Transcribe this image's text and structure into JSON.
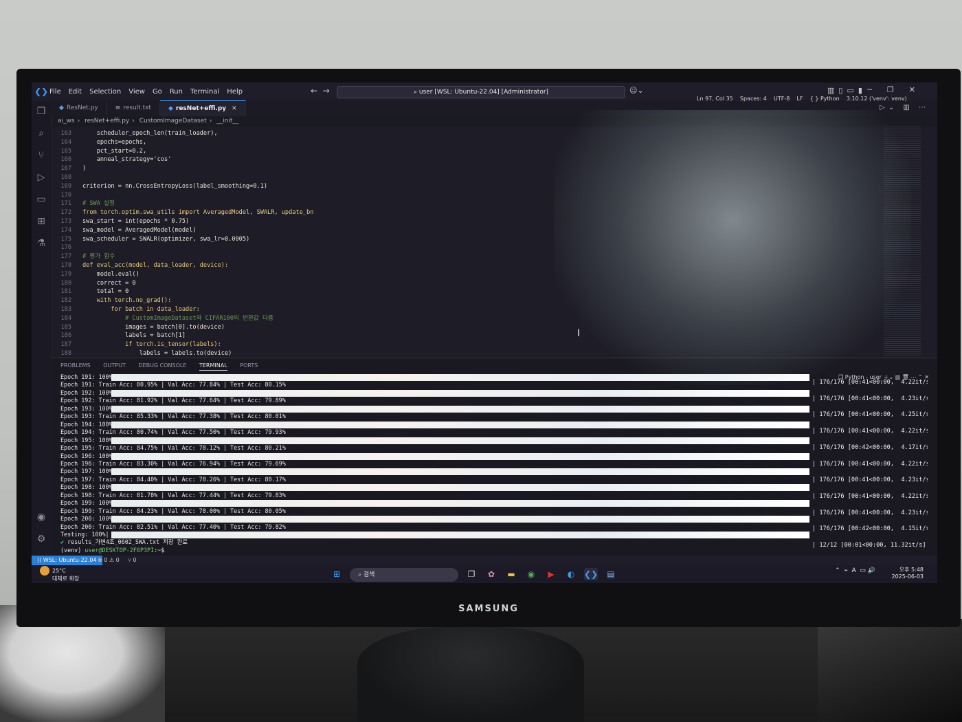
{
  "window": {
    "menu": [
      "File",
      "Edit",
      "Selection",
      "View",
      "Go",
      "Run",
      "Terminal",
      "Help"
    ],
    "command_center": "user [WSL: Ubuntu-22.04] [Administrator]"
  },
  "tabs": [
    {
      "label": "ResNet.py"
    },
    {
      "label": "result.txt"
    },
    {
      "label": "resNet+effi.py",
      "active": true
    }
  ],
  "breadcrumb": [
    "ai_ws",
    "resNet+effi.py",
    "CustomImageDataset",
    "__init__"
  ],
  "editor": {
    "lines": [
      {
        "n": "163",
        "t": "    scheduler_epoch_len(train_loader),"
      },
      {
        "n": "164",
        "t": "    epochs=epochs,"
      },
      {
        "n": "165",
        "t": "    pct_start=0.2,"
      },
      {
        "n": "166",
        "t": "    anneal_strategy='cos'"
      },
      {
        "n": "167",
        "t": ")"
      },
      {
        "n": "168",
        "t": ""
      },
      {
        "n": "169",
        "t": "criterion = nn.CrossEntropyLoss(label_smoothing=0.1)"
      },
      {
        "n": "170",
        "t": ""
      },
      {
        "n": "171",
        "t": "# SWA 설정"
      },
      {
        "n": "172",
        "t": "from torch.optim.swa_utils import AveragedModel, SWALR, update_bn"
      },
      {
        "n": "173",
        "t": "swa_start = int(epochs * 0.75)"
      },
      {
        "n": "174",
        "t": "swa_model = AveragedModel(model)"
      },
      {
        "n": "175",
        "t": "swa_scheduler = SWALR(optimizer, swa_lr=0.0005)"
      },
      {
        "n": "176",
        "t": ""
      },
      {
        "n": "177",
        "t": "# 평가 함수"
      },
      {
        "n": "178",
        "t": "def eval_acc(model, data_loader, device):"
      },
      {
        "n": "179",
        "t": "    model.eval()"
      },
      {
        "n": "180",
        "t": "    correct = 0"
      },
      {
        "n": "181",
        "t": "    total = 0"
      },
      {
        "n": "182",
        "t": "    with torch.no_grad():"
      },
      {
        "n": "183",
        "t": "        for batch in data_loader:"
      },
      {
        "n": "184",
        "t": "            # CustomImageDataset와 CIFAR100의 반환값 다름"
      },
      {
        "n": "185",
        "t": "            images = batch[0].to(device)"
      },
      {
        "n": "186",
        "t": "            labels = batch[1]"
      },
      {
        "n": "187",
        "t": "            if torch.is_tensor(labels):"
      },
      {
        "n": "188",
        "t": "                labels = labels.to(device)"
      }
    ]
  },
  "panel_tabs": [
    "PROBLEMS",
    "OUTPUT",
    "DEBUG CONSOLE",
    "TERMINAL",
    "PORTS"
  ],
  "terminal_profile": "Python - user",
  "terminal": {
    "lines": [
      "Epoch 191: 100%|",
      "Epoch 191: Train Acc: 80.95% | Val Acc: 77.84% | Test Acc: 80.15%",
      "Epoch 192: 100%|",
      "Epoch 192: Train Acc: 81.92% | Val Acc: 77.64% | Test Acc: 79.89%",
      "Epoch 193: 100%|",
      "Epoch 193: Train Acc: 85.33% | Val Acc: 77.38% | Test Acc: 80.01%",
      "Epoch 194: 100%|",
      "Epoch 194: Train Acc: 80.74% | Val Acc: 77.50% | Test Acc: 79.93%",
      "Epoch 195: 100%|",
      "Epoch 195: Train Acc: 84.75% | Val Acc: 78.12% | Test Acc: 80.21%",
      "Epoch 196: 100%|",
      "Epoch 196: Train Acc: 83.30% | Val Acc: 76.94% | Test Acc: 79.69%",
      "Epoch 197: 100%|",
      "Epoch 197: Train Acc: 84.40% | Val Acc: 78.26% | Test Acc: 80.17%",
      "Epoch 198: 100%|",
      "Epoch 198: Train Acc: 81.78% | Val Acc: 77.44% | Test Acc: 79.83%",
      "Epoch 199: 100%|",
      "Epoch 199: Train Acc: 84.23% | Val Acc: 78.00% | Test Acc: 80.05%",
      "Epoch 200: 100%|",
      "Epoch 200: Train Acc: 82.51% | Val Acc: 77.40% | Test Acc: 79.82%",
      "Testing: 100%|"
    ],
    "rates": [
      "| 176/176 [00:41<00:00,  4.22it/s]",
      "| 176/176 [00:41<00:00,  4.23it/s]",
      "| 176/176 [00:41<00:00,  4.25it/s]",
      "| 176/176 [00:41<00:00,  4.22it/s]",
      "| 176/176 [00:42<00:00,  4.17it/s]",
      "| 176/176 [00:41<00:00,  4.22it/s]",
      "| 176/176 [00:41<00:00,  4.23it/s]",
      "| 176/176 [00:41<00:00,  4.22it/s]",
      "| 176/176 [00:41<00:00,  4.23it/s]",
      "| 176/176 [00:42<00:00,  4.15it/s]",
      "| 12/12 [00:01<00:00, 11.32it/s]"
    ],
    "saved": "results_가변4조_0602_SWA.txt 저장 완료",
    "prompt_venv": "(venv) ",
    "prompt_user": "user@DESKTOP-2F6P3PI",
    "prompt_end": ":~$"
  },
  "statusbar": {
    "remote": "WSL: Ubuntu-22.04",
    "problems": "⊗ 0 ⚠ 0",
    "ports": "⑂ 0",
    "right": "Ln 97, Col 35    Spaces: 4    UTF-8    LF    { } Python    3.10.12 ('venv': venv)"
  },
  "taskbar": {
    "temp": "25°C",
    "weather": "대체로 화창",
    "search": "검색",
    "time": "오후 5:48",
    "date": "2025-06-03"
  },
  "monitor_brand": "SAMSUNG"
}
